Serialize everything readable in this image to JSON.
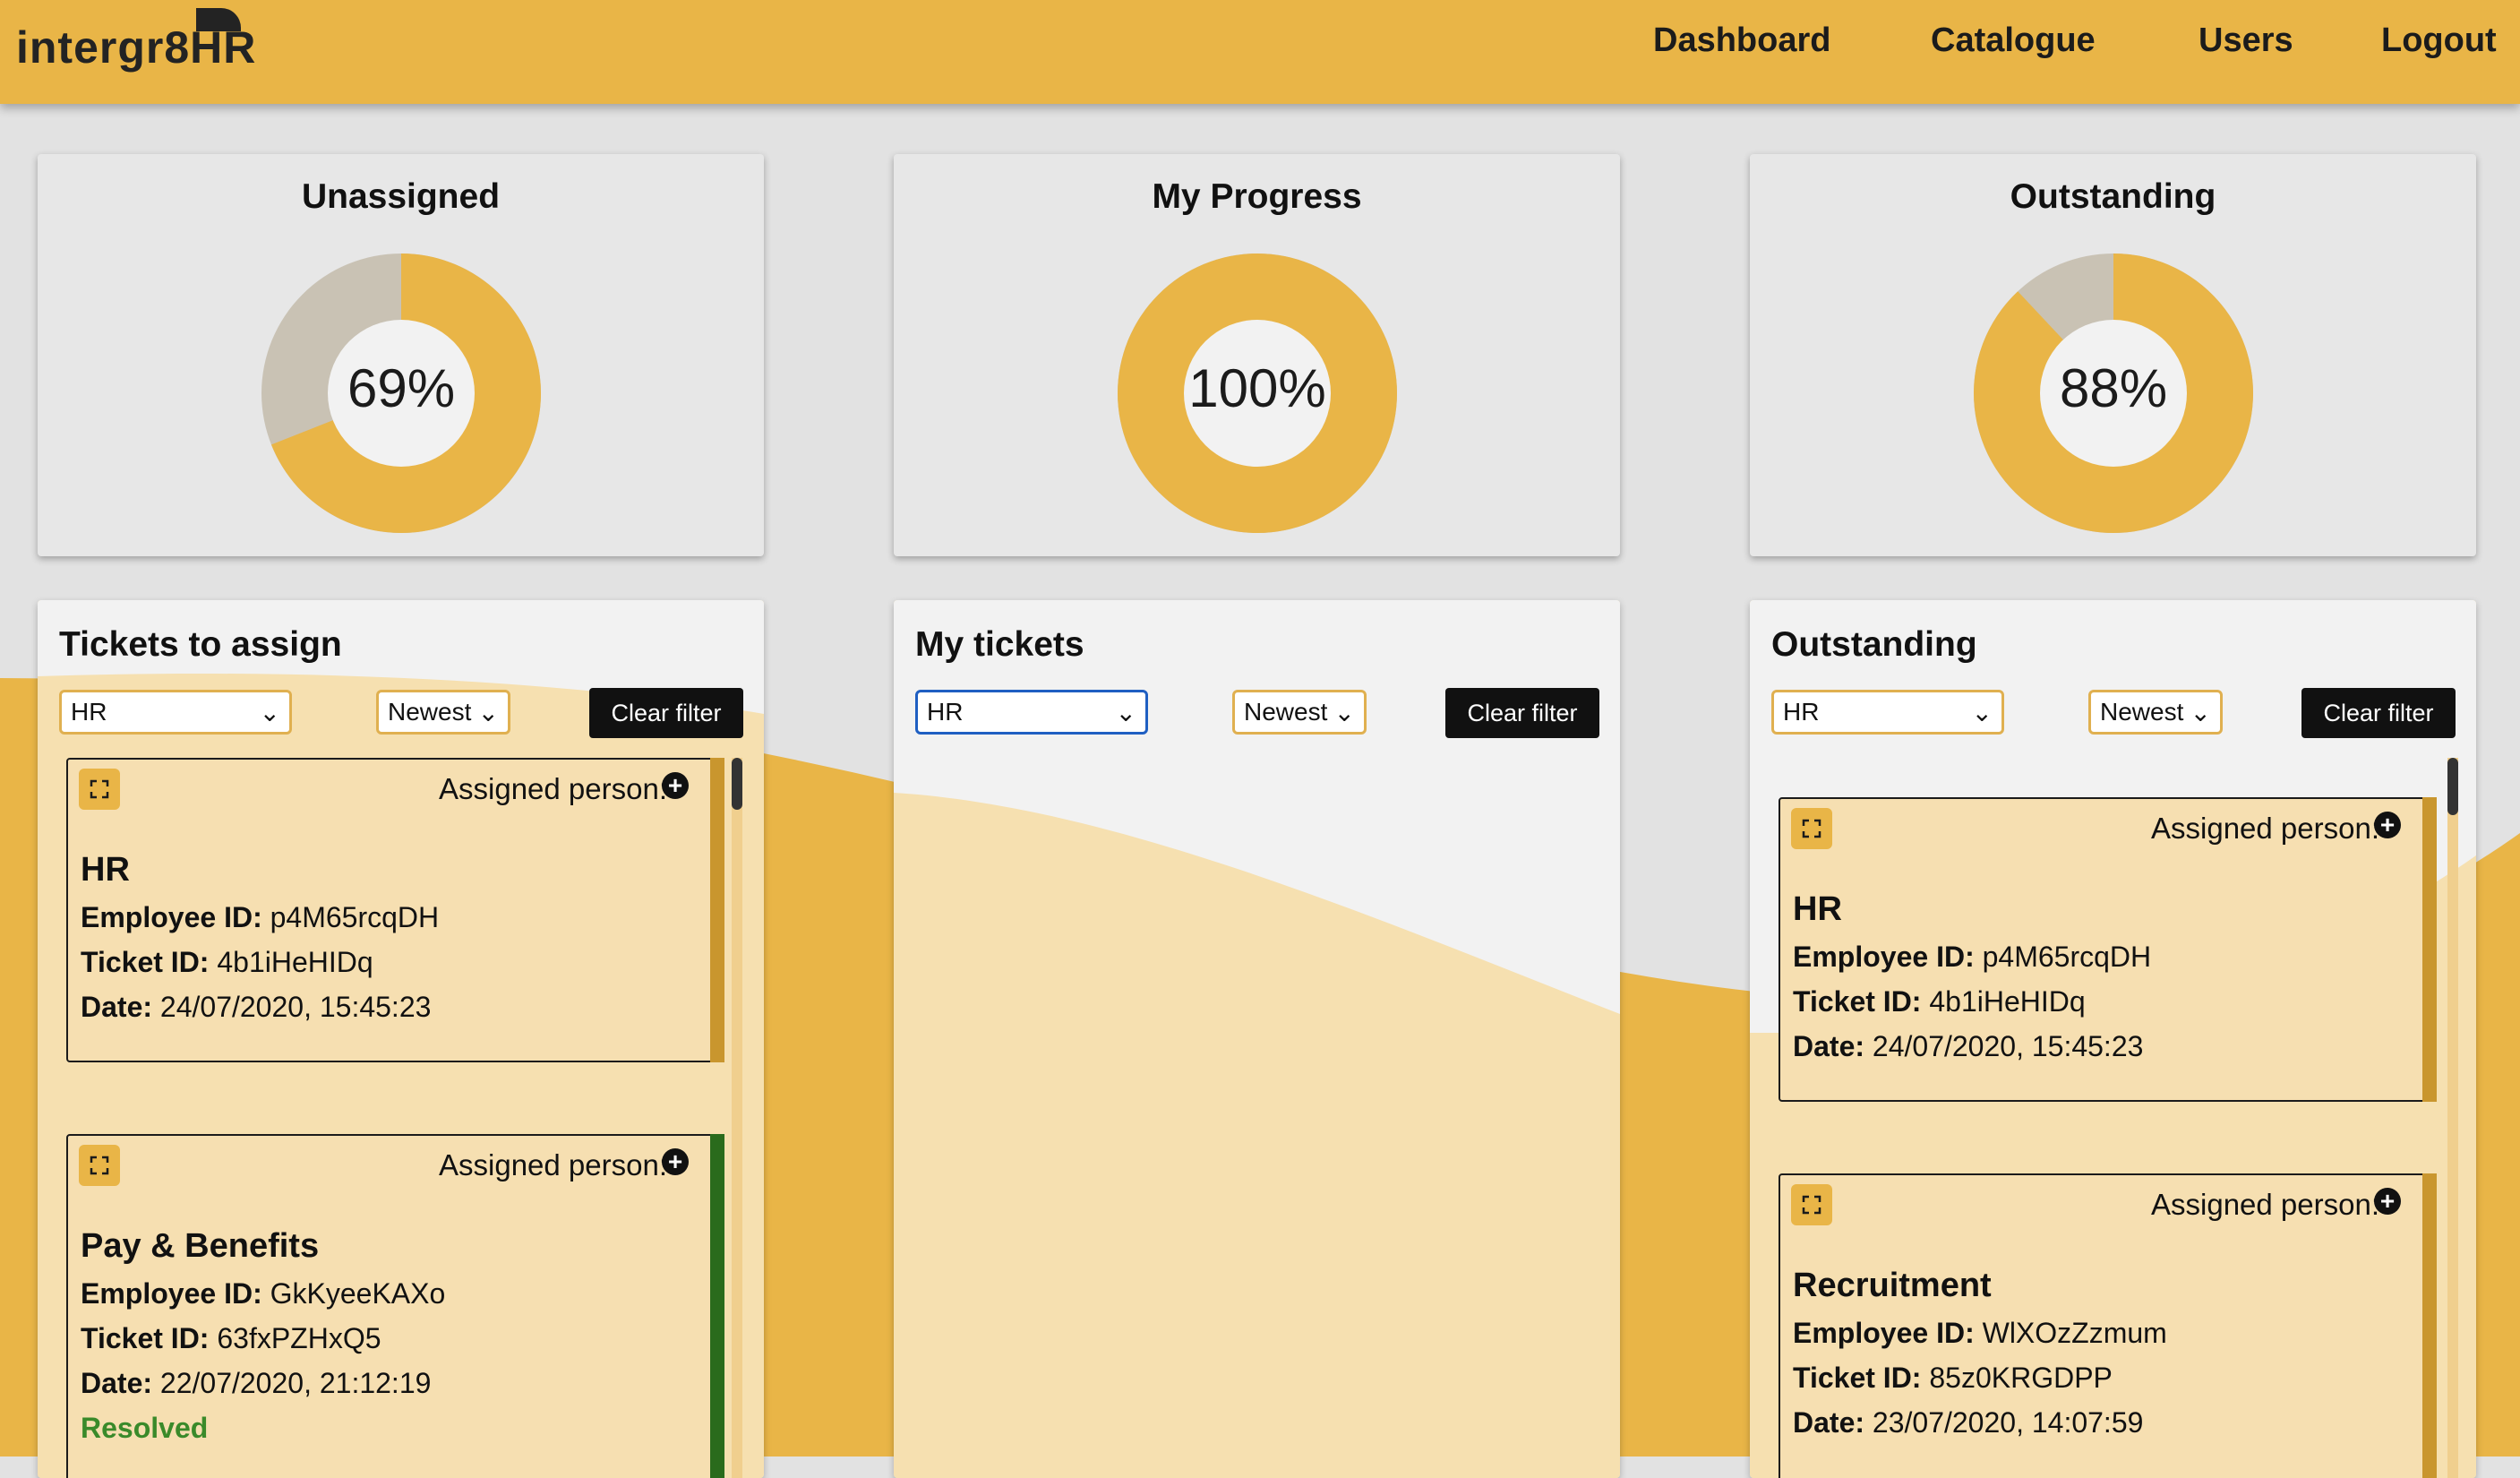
{
  "app": {
    "logo": "intergr8HR"
  },
  "nav": {
    "dashboard": "Dashboard",
    "catalogue": "Catalogue",
    "users": "Users",
    "logout": "Logout"
  },
  "stats": [
    {
      "title": "Unassigned",
      "percent_label": "69%",
      "fraction": 0.69
    },
    {
      "title": "My Progress",
      "percent_label": "100%",
      "fraction": 1.0
    },
    {
      "title": "Outstanding",
      "percent_label": "88%",
      "fraction": 0.88
    }
  ],
  "colors": {
    "accent": "#e9b547",
    "remainder": "#c9c2b4",
    "ticket_bg": "#f6dfb1",
    "resolved": "#3a8a2a",
    "stripe_green": "#2a6b1c",
    "stripe_gold": "#c9962e"
  },
  "panels": {
    "assign": {
      "title": "Tickets to assign",
      "filter_value": "HR",
      "sort_value": "Newest",
      "clear_label": "Clear filter",
      "tickets": [
        {
          "assigned_label": "Assigned person:",
          "category": "HR",
          "employee_label": "Employee ID:",
          "employee_id": "p4M65rcqDH",
          "ticket_label": "Ticket ID:",
          "ticket_id": "4b1iHeHIDq",
          "date_label": "Date:",
          "date": "24/07/2020, 15:45:23"
        },
        {
          "assigned_label": "Assigned person:",
          "category": "Pay & Benefits",
          "employee_label": "Employee ID:",
          "employee_id": "GkKyeeKAXo",
          "ticket_label": "Ticket ID:",
          "ticket_id": "63fxPZHxQ5",
          "date_label": "Date:",
          "date": "22/07/2020, 21:12:19",
          "status": "Resolved"
        }
      ]
    },
    "mine": {
      "title": "My tickets",
      "filter_value": "HR",
      "sort_value": "Newest",
      "clear_label": "Clear filter"
    },
    "outstanding": {
      "title": "Outstanding",
      "filter_value": "HR",
      "sort_value": "Newest",
      "clear_label": "Clear filter",
      "tickets": [
        {
          "assigned_label": "Assigned person:",
          "category": "HR",
          "employee_label": "Employee ID:",
          "employee_id": "p4M65rcqDH",
          "ticket_label": "Ticket ID:",
          "ticket_id": "4b1iHeHIDq",
          "date_label": "Date:",
          "date": "24/07/2020, 15:45:23"
        },
        {
          "assigned_label": "Assigned person:",
          "category": "Recruitment",
          "employee_label": "Employee ID:",
          "employee_id": "WlXOzZzmum",
          "ticket_label": "Ticket ID:",
          "ticket_id": "85z0KRGDPP",
          "date_label": "Date:",
          "date": "23/07/2020, 14:07:59"
        }
      ]
    }
  }
}
